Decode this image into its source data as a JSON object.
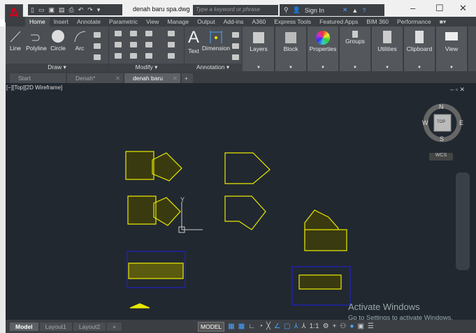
{
  "titlebar": {
    "doc_title": "denah baru spa.dwg",
    "search_placeholder": "Type a keyword or phrase",
    "sign_in": "Sign In",
    "app_letter": "A"
  },
  "ribbon_tabs": [
    "Home",
    "Insert",
    "Annotate",
    "Parametric",
    "View",
    "Manage",
    "Output",
    "Add-ins",
    "A360",
    "Express Tools",
    "Featured Apps",
    "BIM 360",
    "Performance"
  ],
  "panels": {
    "draw": {
      "title": "Draw",
      "tools": [
        "Line",
        "Polyline",
        "Circle",
        "Arc"
      ]
    },
    "modify": {
      "title": "Modify"
    },
    "annotation": {
      "title": "Annotation",
      "tools": [
        "Text",
        "Dimension"
      ]
    },
    "big": [
      "Layers",
      "Block",
      "Properties",
      "Groups",
      "Utilities",
      "Clipboard",
      "View"
    ]
  },
  "doc_tabs": [
    {
      "label": "Start"
    },
    {
      "label": "Denah*"
    },
    {
      "label": "denah baru spa"
    }
  ],
  "viewport": {
    "label": "[−][Top][2D Wireframe]",
    "compass": {
      "n": "N",
      "s": "S",
      "e": "E",
      "w": "W",
      "top": "TOP",
      "wcs": "WCS"
    },
    "ucs_y": "Y"
  },
  "watermark": {
    "title": "Activate Windows",
    "subtitle": "Go to Settings to activate Windows."
  },
  "layout_tabs": [
    "Model",
    "Layout1",
    "Layout2"
  ],
  "status": {
    "model": "MODEL",
    "scale": "1:1"
  },
  "colors": {
    "accent": "#d0021b",
    "viewport_bg": "#212830",
    "drawing": "#e8e800"
  }
}
